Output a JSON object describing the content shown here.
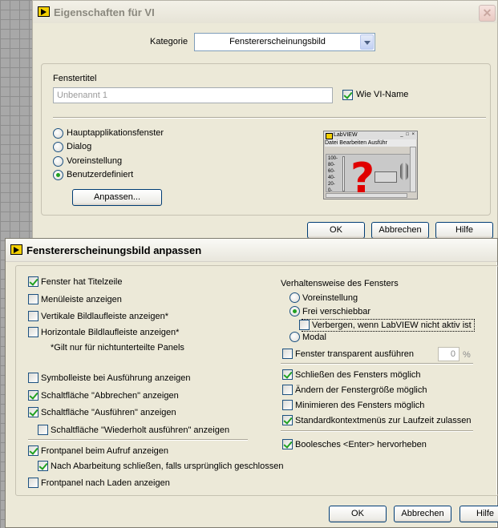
{
  "dialog1": {
    "title": "Eigenschaften für VI",
    "close_glyph": "✕",
    "category_label": "Kategorie",
    "category_value": "Fenstererscheinungsbild",
    "window_title_label": "Fenstertitel",
    "window_title_value": "Unbenannt 1",
    "same_as_vi_name": {
      "label": "Wie VI-Name",
      "checked": true
    },
    "radios": [
      {
        "label": "Hauptapplikationsfenster",
        "checked": false
      },
      {
        "label": "Dialog",
        "checked": false
      },
      {
        "label": "Voreinstellung",
        "checked": false
      },
      {
        "label": "Benutzerdefiniert",
        "checked": true
      }
    ],
    "customize_button": "Anpassen...",
    "preview": {
      "title": "LabVIEW",
      "menu": "Datei  Bearbeiten  Ausführ",
      "buttons": "_ □ ×",
      "scale": [
        "100-",
        "80-",
        "60-",
        "40-",
        "20-",
        "0-"
      ]
    },
    "ok_button": "OK",
    "cancel_button": "Abbrechen",
    "help_button": "Hilfe"
  },
  "dialog2": {
    "title": "Fenstererscheinungsbild anpassen",
    "left_options": [
      {
        "label": "Fenster hat Titelzeile",
        "checked": true
      },
      {
        "label": "Menüleiste anzeigen",
        "checked": false
      },
      {
        "label": "Vertikale Bildlaufleiste anzeigen*",
        "checked": false
      },
      {
        "label": "Horizontale Bildlaufleiste anzeigen*",
        "checked": false
      }
    ],
    "note": "*Gilt nur für nichtunterteilte Panels",
    "toolbar_options": [
      {
        "label": "Symbolleiste bei Ausführung anzeigen",
        "checked": false
      },
      {
        "label": "Schaltfläche \"Abbrechen\" anzeigen",
        "checked": true
      },
      {
        "label": "Schaltfläche \"Ausführen\" anzeigen",
        "checked": true
      },
      {
        "label": "Schaltfläche \"Wiederholt ausführen\" anzeigen",
        "checked": false
      }
    ],
    "frontpanel_options": [
      {
        "label": "Frontpanel beim Aufruf anzeigen",
        "checked": true
      },
      {
        "label": "Nach Abarbeitung schließen, falls ursprünglich geschlossen",
        "checked": true
      },
      {
        "label": "Frontpanel nach Laden anzeigen",
        "checked": false
      }
    ],
    "behavior_heading": "Verhaltensweise des Fensters",
    "behavior_radios": [
      {
        "label": "Voreinstellung",
        "checked": false
      },
      {
        "label": "Frei verschiebbar",
        "checked": true
      }
    ],
    "hide_option": {
      "label": "Verbergen, wenn LabVIEW nicht aktiv ist",
      "checked": false
    },
    "modal_radio": {
      "label": "Modal",
      "checked": false
    },
    "transparent": {
      "label": "Fenster transparent ausführen",
      "checked": false,
      "value": "0",
      "unit": "%"
    },
    "right_options": [
      {
        "label": "Schließen des Fensters möglich",
        "checked": true
      },
      {
        "label": "Ändern der Fenstergröße möglich",
        "checked": false
      },
      {
        "label": "Minimieren des Fensters möglich",
        "checked": false
      },
      {
        "label": "Standardkontextmenüs zur Laufzeit zulassen",
        "checked": true
      }
    ],
    "boolean_enter": {
      "label": "Boolesches <Enter> hervorheben",
      "checked": true
    },
    "ok_button": "OK",
    "cancel_button": "Abbrechen",
    "help_button": "Hilfe"
  }
}
